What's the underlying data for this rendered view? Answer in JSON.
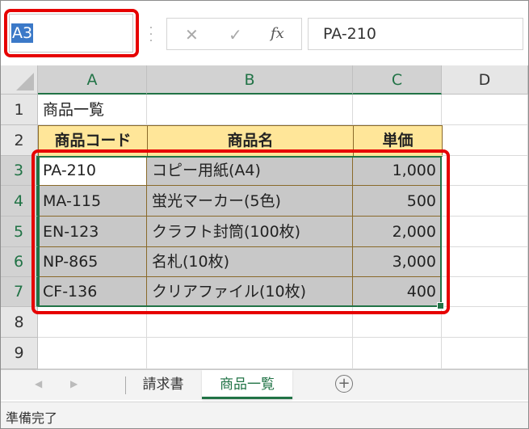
{
  "name_box": {
    "value": "A3"
  },
  "formula_bar": {
    "cancel_icon": "✕",
    "enter_icon": "✓",
    "fx_label": "fx",
    "content": "PA-210"
  },
  "columns": [
    "A",
    "B",
    "C",
    "D"
  ],
  "rows": [
    "1",
    "2",
    "3",
    "4",
    "5",
    "6",
    "7",
    "8",
    "9"
  ],
  "sheet": {
    "title": "商品一覧",
    "headers": {
      "code": "商品コード",
      "name": "商品名",
      "price": "単価"
    },
    "items": [
      {
        "code": "PA-210",
        "name": "コピー用紙(A4)",
        "price": "1,000"
      },
      {
        "code": "MA-115",
        "name": "蛍光マーカー(5色)",
        "price": "500"
      },
      {
        "code": "EN-123",
        "name": "クラフト封筒(100枚)",
        "price": "2,000"
      },
      {
        "code": "NP-865",
        "name": "名札(10枚)",
        "price": "3,000"
      },
      {
        "code": "CF-136",
        "name": "クリアファイル(10枚)",
        "price": "400"
      }
    ]
  },
  "tabs": {
    "prev_icon": "◀",
    "next_icon": "▶",
    "items": [
      "請求書",
      "商品一覧"
    ],
    "active": "商品一覧",
    "add_icon": "+"
  },
  "status": {
    "text": "準備完了"
  },
  "colors": {
    "accent_green": "#217346",
    "highlight_red": "#e60000",
    "header_fill": "#ffe699",
    "selection_fill": "#c8c8c8"
  }
}
